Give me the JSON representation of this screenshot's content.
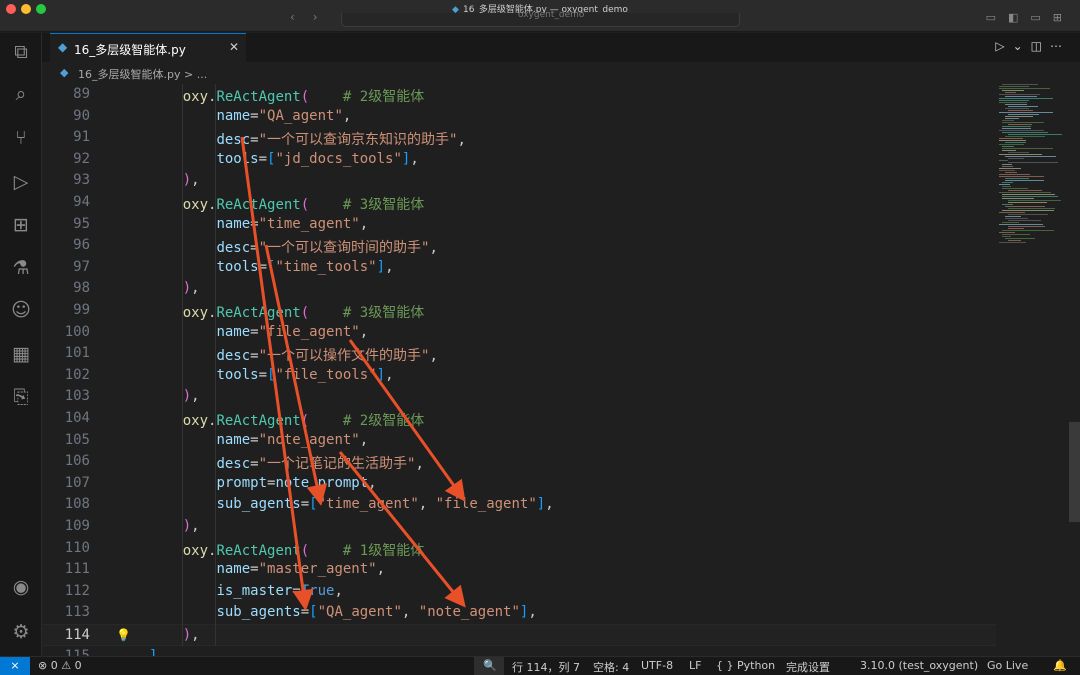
{
  "window": {
    "title": "16_多层级智能体.py — oxygent_demo",
    "search_text": "oxygent_demo"
  },
  "activity_icons": [
    "files-icon",
    "search-icon",
    "source-control-icon",
    "run-debug-icon",
    "extensions-icon",
    "testing-icon",
    "copilot-icon",
    "package-icon",
    "remote-explorer-icon",
    "account-icon",
    "settings-gear-icon"
  ],
  "tab": {
    "label": "16_多层级智能体.py",
    "close": "✕"
  },
  "breadcrumb": {
    "file": "16_多层级智能体.py",
    "sep": " > ",
    "more": "..."
  },
  "editor": {
    "current_line": 114,
    "lines": [
      {
        "n": 89,
        "indent": 4,
        "tokens": [
          [
            "f",
            "oxy"
          ],
          [
            "pl",
            "."
          ],
          [
            "fn",
            "ReActAgent"
          ],
          [
            "p1",
            "("
          ],
          [
            "pl",
            "    "
          ],
          [
            "c",
            "# 2级智能体"
          ]
        ]
      },
      {
        "n": 90,
        "indent": 8,
        "tokens": [
          [
            "v",
            "name"
          ],
          [
            "pl",
            "="
          ],
          [
            "s",
            "\"QA_agent\""
          ],
          [
            "pl",
            ","
          ]
        ]
      },
      {
        "n": 91,
        "indent": 8,
        "tokens": [
          [
            "v",
            "desc"
          ],
          [
            "pl",
            "="
          ],
          [
            "s",
            "\"一个可以查询京东知识的助手\""
          ],
          [
            "pl",
            ","
          ]
        ]
      },
      {
        "n": 92,
        "indent": 8,
        "tokens": [
          [
            "v",
            "tools"
          ],
          [
            "pl",
            "="
          ],
          [
            "p2",
            "["
          ],
          [
            "s",
            "\"jd_docs_tools\""
          ],
          [
            "p2",
            "]"
          ],
          [
            "pl",
            ","
          ]
        ]
      },
      {
        "n": 93,
        "indent": 4,
        "tokens": [
          [
            "p1",
            ")"
          ],
          [
            "pl",
            ","
          ]
        ]
      },
      {
        "n": 94,
        "indent": 4,
        "tokens": [
          [
            "f",
            "oxy"
          ],
          [
            "pl",
            "."
          ],
          [
            "fn",
            "ReActAgent"
          ],
          [
            "p1",
            "("
          ],
          [
            "pl",
            "    "
          ],
          [
            "c",
            "# 3级智能体"
          ]
        ]
      },
      {
        "n": 95,
        "indent": 8,
        "tokens": [
          [
            "v",
            "name"
          ],
          [
            "pl",
            "="
          ],
          [
            "s",
            "\"time_agent\""
          ],
          [
            "pl",
            ","
          ]
        ]
      },
      {
        "n": 96,
        "indent": 8,
        "tokens": [
          [
            "v",
            "desc"
          ],
          [
            "pl",
            "="
          ],
          [
            "s",
            "\"一个可以查询时间的助手\""
          ],
          [
            "pl",
            ","
          ]
        ]
      },
      {
        "n": 97,
        "indent": 8,
        "tokens": [
          [
            "v",
            "tools"
          ],
          [
            "pl",
            "="
          ],
          [
            "p2",
            "["
          ],
          [
            "s",
            "\"time_tools\""
          ],
          [
            "p2",
            "]"
          ],
          [
            "pl",
            ","
          ]
        ]
      },
      {
        "n": 98,
        "indent": 4,
        "tokens": [
          [
            "p1",
            ")"
          ],
          [
            "pl",
            ","
          ]
        ]
      },
      {
        "n": 99,
        "indent": 4,
        "tokens": [
          [
            "f",
            "oxy"
          ],
          [
            "pl",
            "."
          ],
          [
            "fn",
            "ReActAgent"
          ],
          [
            "p1",
            "("
          ],
          [
            "pl",
            "    "
          ],
          [
            "c",
            "# 3级智能体"
          ]
        ]
      },
      {
        "n": 100,
        "indent": 8,
        "tokens": [
          [
            "v",
            "name"
          ],
          [
            "pl",
            "="
          ],
          [
            "s",
            "\"file_agent\""
          ],
          [
            "pl",
            ","
          ]
        ]
      },
      {
        "n": 101,
        "indent": 8,
        "tokens": [
          [
            "v",
            "desc"
          ],
          [
            "pl",
            "="
          ],
          [
            "s",
            "\"一个可以操作文件的助手\""
          ],
          [
            "pl",
            ","
          ]
        ]
      },
      {
        "n": 102,
        "indent": 8,
        "tokens": [
          [
            "v",
            "tools"
          ],
          [
            "pl",
            "="
          ],
          [
            "p2",
            "["
          ],
          [
            "s",
            "\"file_tools\""
          ],
          [
            "p2",
            "]"
          ],
          [
            "pl",
            ","
          ]
        ]
      },
      {
        "n": 103,
        "indent": 4,
        "tokens": [
          [
            "p1",
            ")"
          ],
          [
            "pl",
            ","
          ]
        ]
      },
      {
        "n": 104,
        "indent": 4,
        "tokens": [
          [
            "f",
            "oxy"
          ],
          [
            "pl",
            "."
          ],
          [
            "fn",
            "ReActAgent"
          ],
          [
            "p1",
            "("
          ],
          [
            "pl",
            "    "
          ],
          [
            "c",
            "# 2级智能体"
          ]
        ]
      },
      {
        "n": 105,
        "indent": 8,
        "tokens": [
          [
            "v",
            "name"
          ],
          [
            "pl",
            "="
          ],
          [
            "s",
            "\"note_agent\""
          ],
          [
            "pl",
            ","
          ]
        ]
      },
      {
        "n": 106,
        "indent": 8,
        "tokens": [
          [
            "v",
            "desc"
          ],
          [
            "pl",
            "="
          ],
          [
            "s",
            "\"一个记笔记的生活助手\""
          ],
          [
            "pl",
            ","
          ]
        ]
      },
      {
        "n": 107,
        "indent": 8,
        "tokens": [
          [
            "v",
            "prompt"
          ],
          [
            "pl",
            "="
          ],
          [
            "v",
            "note_prompt"
          ],
          [
            "pl",
            ","
          ]
        ]
      },
      {
        "n": 108,
        "indent": 8,
        "tokens": [
          [
            "v",
            "sub_agents"
          ],
          [
            "pl",
            "="
          ],
          [
            "p2",
            "["
          ],
          [
            "s",
            "\"time_agent\""
          ],
          [
            "pl",
            ", "
          ],
          [
            "s",
            "\"file_agent\""
          ],
          [
            "p2",
            "]"
          ],
          [
            "pl",
            ","
          ]
        ]
      },
      {
        "n": 109,
        "indent": 4,
        "tokens": [
          [
            "p1",
            ")"
          ],
          [
            "pl",
            ","
          ]
        ]
      },
      {
        "n": 110,
        "indent": 4,
        "tokens": [
          [
            "f",
            "oxy"
          ],
          [
            "pl",
            "."
          ],
          [
            "fn",
            "ReActAgent"
          ],
          [
            "p1",
            "("
          ],
          [
            "pl",
            "    "
          ],
          [
            "c",
            "# 1级智能体"
          ]
        ]
      },
      {
        "n": 111,
        "indent": 8,
        "tokens": [
          [
            "v",
            "name"
          ],
          [
            "pl",
            "="
          ],
          [
            "s",
            "\"master_agent\""
          ],
          [
            "pl",
            ","
          ]
        ]
      },
      {
        "n": 112,
        "indent": 8,
        "tokens": [
          [
            "v",
            "is_master"
          ],
          [
            "pl",
            "="
          ],
          [
            "k",
            "True"
          ],
          [
            "pl",
            ","
          ]
        ]
      },
      {
        "n": 113,
        "indent": 8,
        "tokens": [
          [
            "v",
            "sub_agents"
          ],
          [
            "pl",
            "="
          ],
          [
            "p2",
            "["
          ],
          [
            "s",
            "\"QA_agent\""
          ],
          [
            "pl",
            ", "
          ],
          [
            "s",
            "\"note_agent\""
          ],
          [
            "p2",
            "]"
          ],
          [
            "pl",
            ","
          ]
        ]
      },
      {
        "n": 114,
        "indent": 4,
        "tokens": [
          [
            "p1",
            ")"
          ],
          [
            "pl",
            ","
          ]
        ]
      },
      {
        "n": 115,
        "indent": 0,
        "tokens": [
          [
            "p2",
            "]"
          ]
        ]
      }
    ]
  },
  "annotation_color": "#e8502a",
  "statusbar": {
    "remote": "⨯",
    "problems": "⊗ 0 ⚠ 0",
    "zoom_icon": "🔍",
    "position": "行 114，列 7",
    "spaces": "空格: 4",
    "encoding": "UTF-8",
    "eol": "LF",
    "language": "{ } Python",
    "setup": "完成设置",
    "interpreter": "3.10.0 (test_oxygent)",
    "golive": "Go Live",
    "bell": "🔔"
  }
}
